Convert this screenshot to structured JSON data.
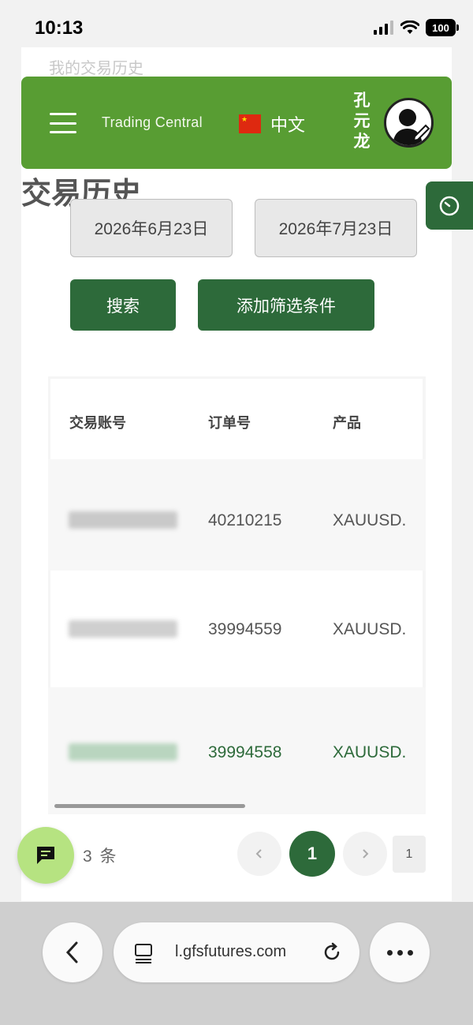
{
  "status": {
    "time": "10:13",
    "battery": "100"
  },
  "page": {
    "ghost_title": "我的交易历史",
    "title": "交易历史"
  },
  "header": {
    "brand": "Trading Central",
    "language": "中文",
    "username": "孔元龙"
  },
  "filters": {
    "start_date": "2026年6月23日",
    "end_date": "2026年7月23日",
    "search_label": "搜索",
    "add_filter_label": "添加筛选条件"
  },
  "table": {
    "headers": [
      "交易账号",
      "订单号",
      "产品"
    ],
    "rows": [
      {
        "order": "40210215",
        "product": "XAUUSD."
      },
      {
        "order": "39994559",
        "product": "XAUUSD."
      },
      {
        "order": "39994558",
        "product": "XAUUSD."
      }
    ]
  },
  "pagination": {
    "count": "3 条",
    "current": "1",
    "total": "1"
  },
  "browser": {
    "url": "l.gfsfutures.com"
  },
  "colors": {
    "header_green": "#589d33",
    "dark_green": "#2d6a3a",
    "fab_green": "#b6e381"
  }
}
